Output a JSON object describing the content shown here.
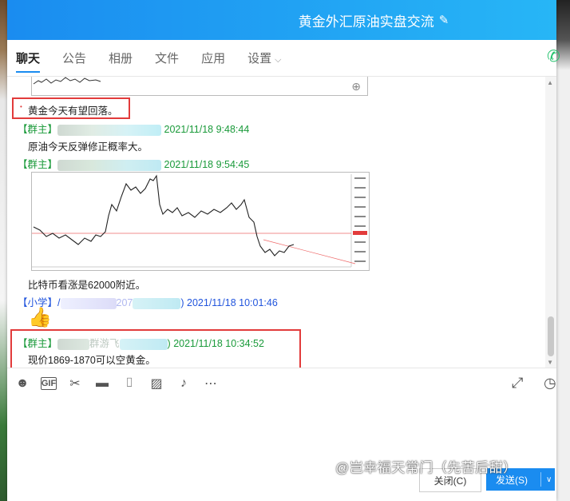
{
  "window": {
    "title": "黄金外汇原油实盘交流"
  },
  "tabs": [
    {
      "label": "聊天"
    },
    {
      "label": "公告"
    },
    {
      "label": "相册"
    },
    {
      "label": "文件"
    },
    {
      "label": "应用"
    },
    {
      "label": "设置"
    }
  ],
  "messages": [
    {
      "text": "黄金今天有望回落。"
    },
    {
      "role": "【群主】",
      "timestamp": "2021/11/18 9:48:44",
      "text": "原油今天反弹修正概率大。"
    },
    {
      "role": "【群主】",
      "timestamp": "2021/11/18 9:54:45",
      "text": "比特币看涨是62000附近。"
    },
    {
      "role": "【小学】",
      "name_suffix": "207",
      "timestamp": "2021/11/18 10:01:46",
      "emoji": "👍"
    },
    {
      "role": "【群主】",
      "name_mid": "群游飞",
      "timestamp": "2021/11/18 10:34:52",
      "text": "现价1869-1870可以空黄金。"
    }
  ],
  "footer": {
    "close_label": "关闭(C)",
    "send_label": "发送(S)"
  },
  "watermark": "@岂幸福天常门（先苦后甜）",
  "colors": {
    "titlebar": "#1a8cf0",
    "owner": "#1a9a3a",
    "student": "#2255dd",
    "highlight": "#e23b3b"
  }
}
